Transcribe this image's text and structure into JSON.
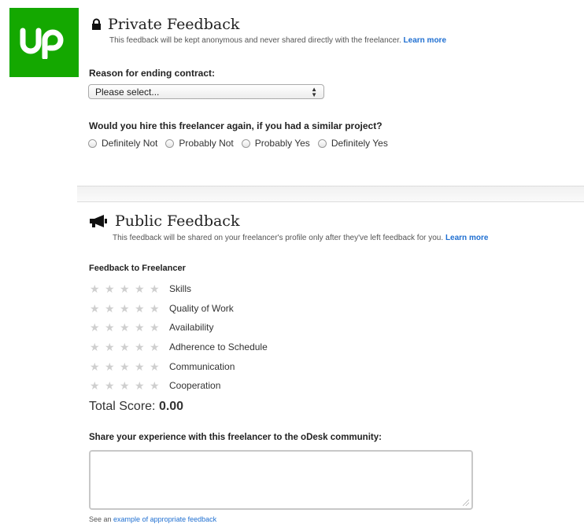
{
  "brand": {
    "logo_text": "up",
    "color": "#14a800"
  },
  "private": {
    "title": "Private Feedback",
    "icon": "lock-icon",
    "subtitle": "This feedback will be kept anonymous and never shared directly with the freelancer.",
    "learn_more": "Learn more",
    "reason_label": "Reason for ending contract:",
    "reason_value": "Please select...",
    "hire_question": "Would you hire this freelancer again, if you had a similar project?",
    "hire_options": [
      "Definitely Not",
      "Probably Not",
      "Probably Yes",
      "Definitely Yes"
    ]
  },
  "public": {
    "title": "Public Feedback",
    "icon": "megaphone-icon",
    "subtitle": "This feedback will be shared on your freelancer's profile only after they've left feedback for you.",
    "learn_more": "Learn more",
    "feedback_heading": "Feedback to Freelancer",
    "criteria": [
      {
        "label": "Skills",
        "rating": 0
      },
      {
        "label": "Quality of Work",
        "rating": 0
      },
      {
        "label": "Availability",
        "rating": 0
      },
      {
        "label": "Adherence to Schedule",
        "rating": 0
      },
      {
        "label": "Communication",
        "rating": 0
      },
      {
        "label": "Cooperation",
        "rating": 0
      }
    ],
    "total_label": "Total Score:",
    "total_value": "0.00",
    "share_label": "Share your experience with this freelancer to the oDesk community:",
    "share_value": "",
    "footer_prefix": "See an",
    "footer_link": "example of appropriate feedback"
  },
  "colors": {
    "link": "#1f6fd1",
    "star_empty": "#cfcfcf"
  }
}
